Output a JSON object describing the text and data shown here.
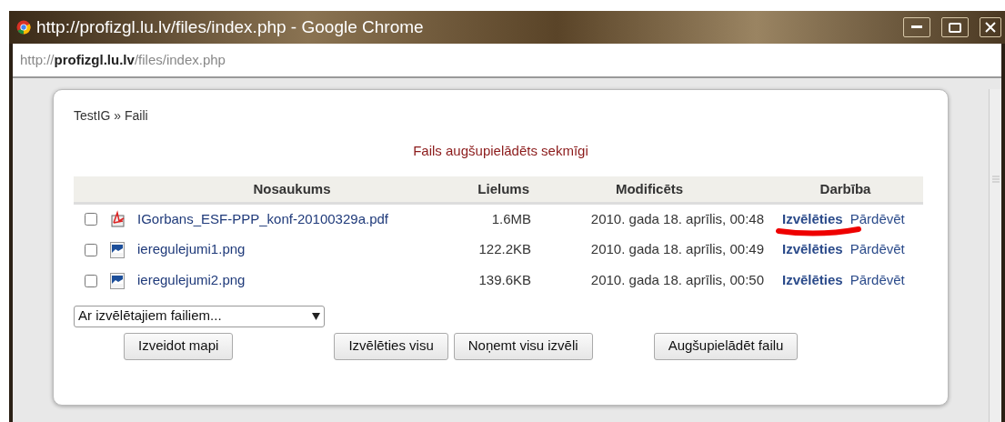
{
  "window": {
    "title": "http://profizgl.lu.lv/files/index.php - Google Chrome"
  },
  "address_bar": {
    "url": "http://**profizgl.lu.lv**/files/index.php"
  },
  "breadcrumb": "TestIG » Faili",
  "message": "Fails augšupielādēts sekmīgi",
  "table": {
    "columns": [
      "Nosaukums",
      "Lielums",
      "Modificēts",
      "Darbība"
    ],
    "rows": [
      {
        "kind": "pdf",
        "checked": false,
        "name": "IGorbans_ESF-PPP_konf-20100329a.pdf",
        "size": "1.6MB",
        "modified": "2010. gada 18. aprīlis, 00:48",
        "actions": [
          "Izvēlēties",
          "Pārdēvēt"
        ],
        "underlined": true
      },
      {
        "kind": "image",
        "checked": false,
        "name": "ieregulejumi1.png",
        "size": "122.2KB",
        "modified": "2010. gada 18. aprīlis, 00:49",
        "actions": [
          "Izvēlēties",
          "Pārdēvēt"
        ],
        "underlined": false
      },
      {
        "kind": "image",
        "checked": false,
        "name": "ieregulejumi2.png",
        "size": "139.6KB",
        "modified": "2010. gada 18. aprīlis, 00:50",
        "actions": [
          "Izvēlēties",
          "Pārdēvēt"
        ],
        "underlined": false
      }
    ]
  },
  "bulk_select": {
    "value": "Ar izvēlētajiem failiem..."
  },
  "buttons": [
    "Izveidot mapi",
    "Izvēlēties visu",
    "Noņemt visu izvēli",
    "Augšupielādēt failu"
  ]
}
